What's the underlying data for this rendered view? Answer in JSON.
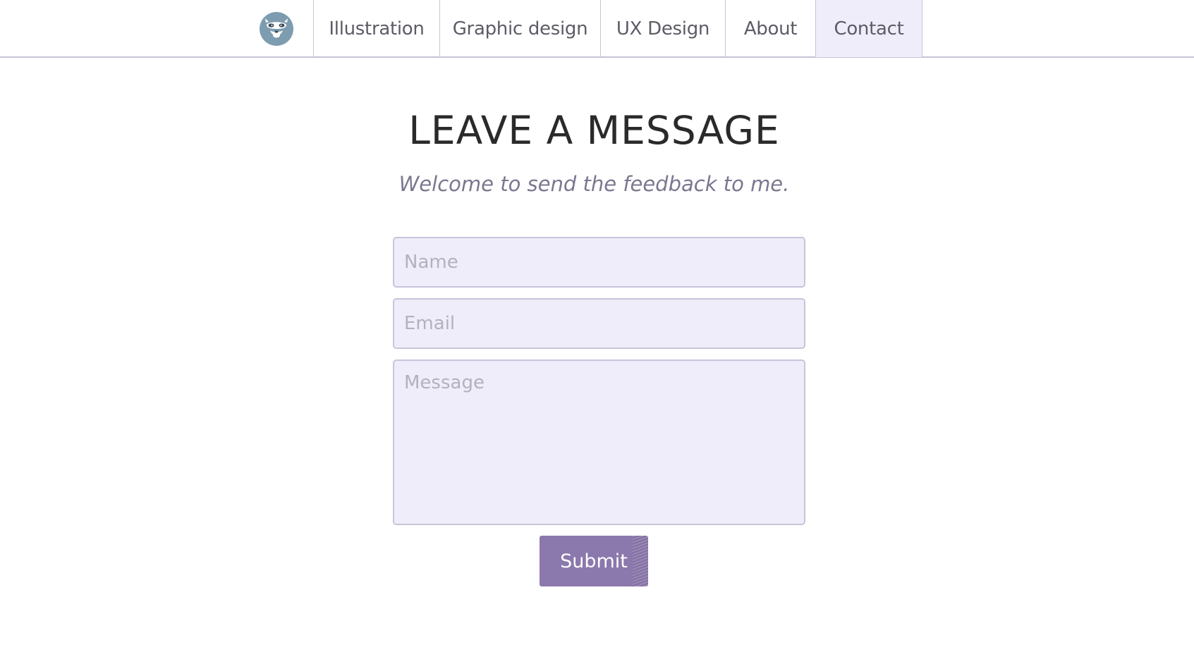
{
  "nav": {
    "logo_icon": "ferret-face-icon",
    "items": [
      {
        "label": "Illustration"
      },
      {
        "label": "Graphic design"
      },
      {
        "label": "UX Design"
      },
      {
        "label": "About"
      },
      {
        "label": "Contact",
        "active": true
      }
    ]
  },
  "header": {
    "title": "LEAVE A MESSAGE",
    "subtitle": "Welcome to send the feedback to me."
  },
  "form": {
    "name_placeholder": "Name",
    "email_placeholder": "Email",
    "message_placeholder": "Message",
    "submit_label": "Submit"
  },
  "colors": {
    "accent": "#8b78ac",
    "field_bg": "#efedf9",
    "border": "#c9c4da",
    "logo": "#7d9caf"
  }
}
